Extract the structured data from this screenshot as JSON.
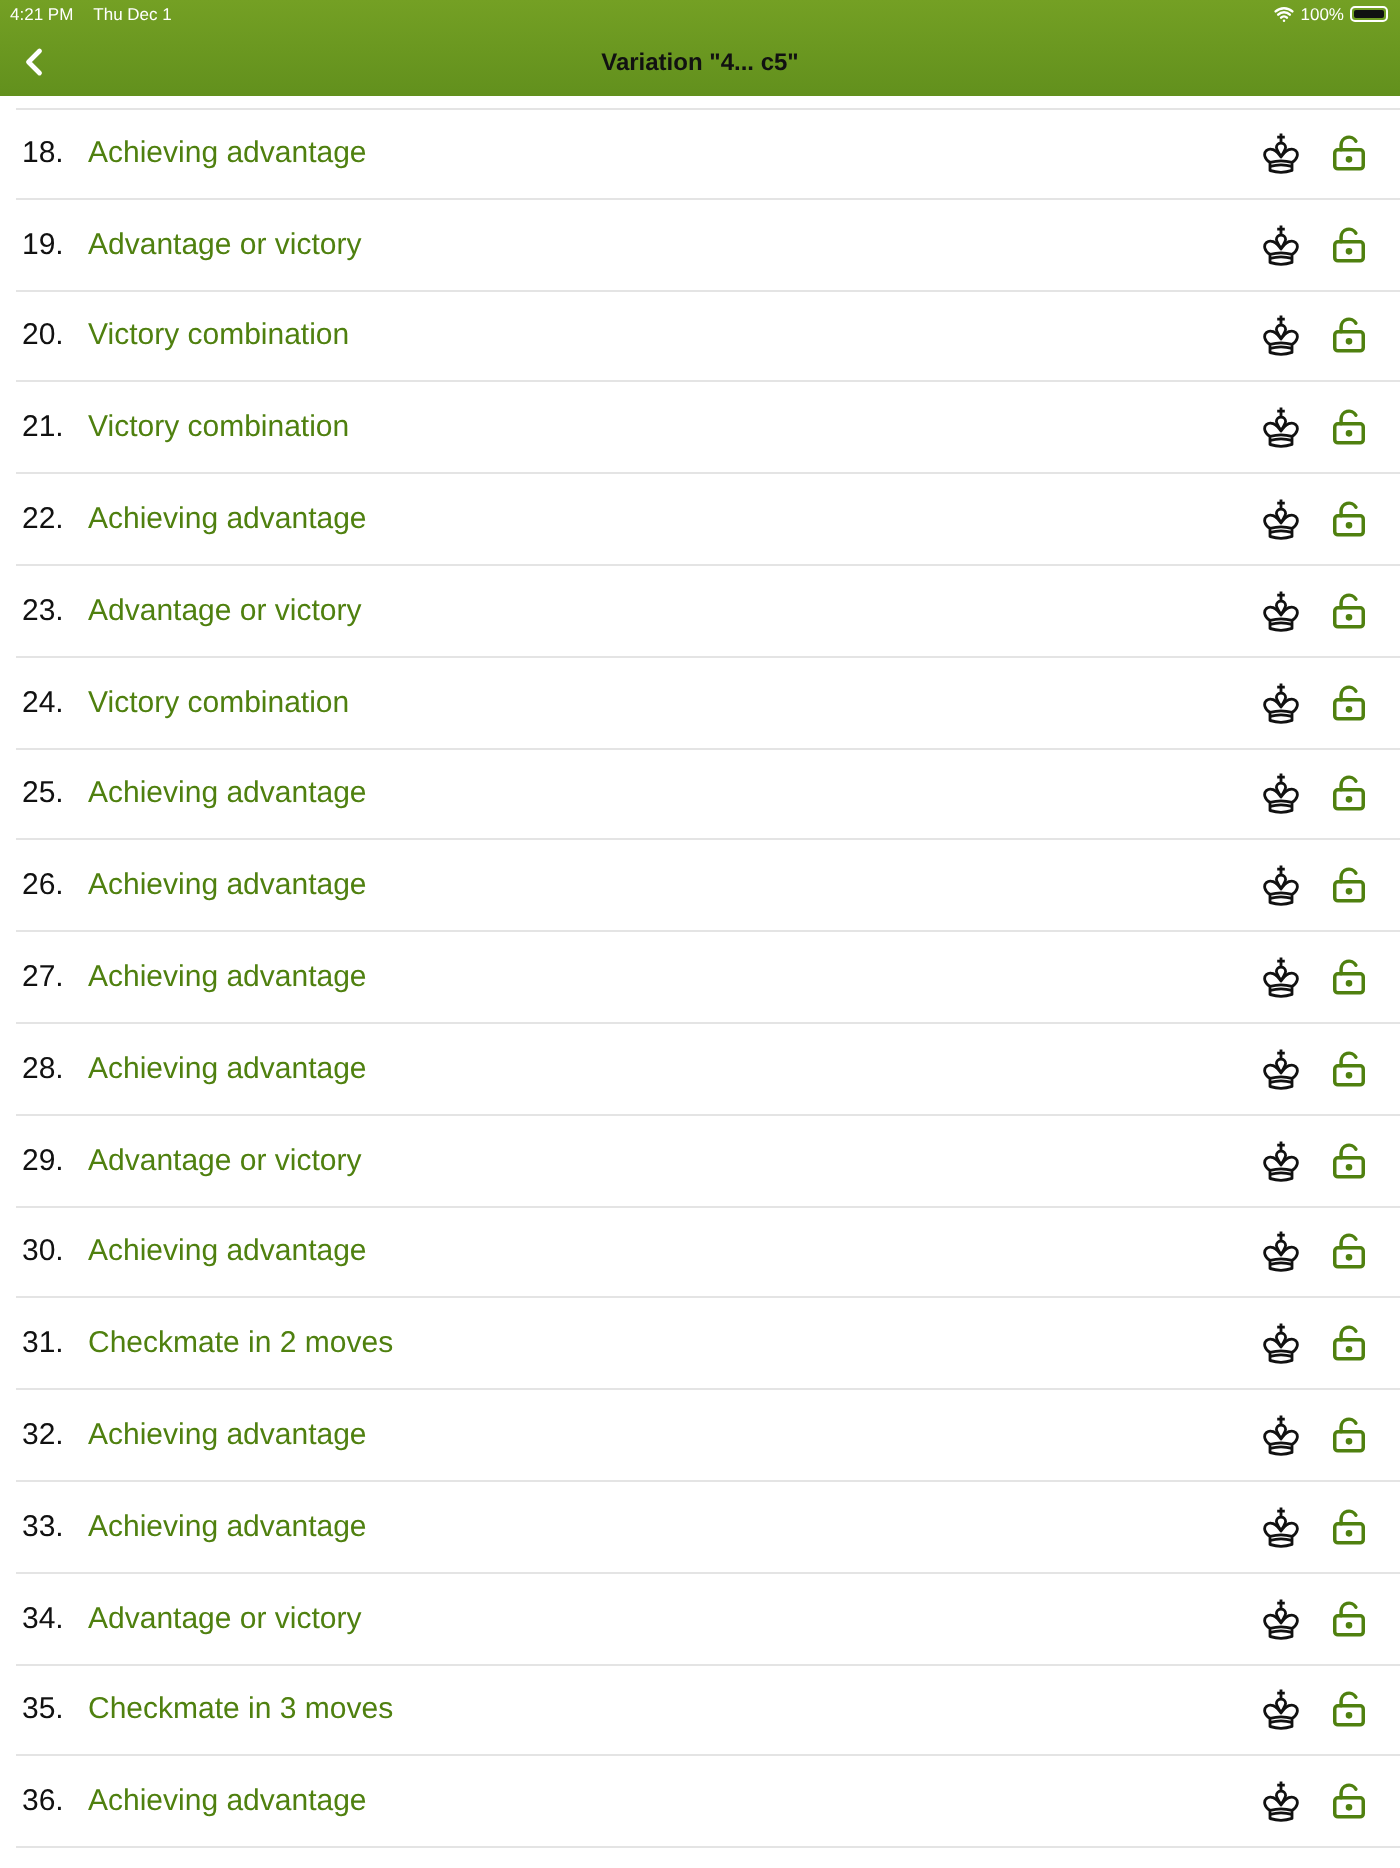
{
  "status_bar": {
    "time": "4:21 PM",
    "date": "Thu Dec 1",
    "battery": "100%"
  },
  "nav_bar": {
    "title": "Variation \"4... c5\""
  },
  "exercises": [
    {
      "number": "18.",
      "title": "Achieving advantage",
      "locked": false
    },
    {
      "number": "19.",
      "title": "Advantage or victory",
      "locked": false
    },
    {
      "number": "20.",
      "title": "Victory combination",
      "locked": false
    },
    {
      "number": "21.",
      "title": "Victory combination",
      "locked": false
    },
    {
      "number": "22.",
      "title": "Achieving advantage",
      "locked": false
    },
    {
      "number": "23.",
      "title": "Advantage or victory",
      "locked": false
    },
    {
      "number": "24.",
      "title": "Victory combination",
      "locked": false
    },
    {
      "number": "25.",
      "title": "Achieving advantage",
      "locked": false
    },
    {
      "number": "26.",
      "title": "Achieving advantage",
      "locked": false
    },
    {
      "number": "27.",
      "title": "Achieving advantage",
      "locked": false
    },
    {
      "number": "28.",
      "title": "Achieving advantage",
      "locked": false
    },
    {
      "number": "29.",
      "title": "Advantage or victory",
      "locked": false
    },
    {
      "number": "30.",
      "title": "Achieving advantage",
      "locked": false
    },
    {
      "number": "31.",
      "title": "Checkmate in 2 moves",
      "locked": false
    },
    {
      "number": "32.",
      "title": "Achieving advantage",
      "locked": false
    },
    {
      "number": "33.",
      "title": "Achieving advantage",
      "locked": false
    },
    {
      "number": "34.",
      "title": "Advantage or victory",
      "locked": false
    },
    {
      "number": "35.",
      "title": "Checkmate in 3 moves",
      "locked": false
    },
    {
      "number": "36.",
      "title": "Achieving advantage",
      "locked": false
    }
  ]
}
